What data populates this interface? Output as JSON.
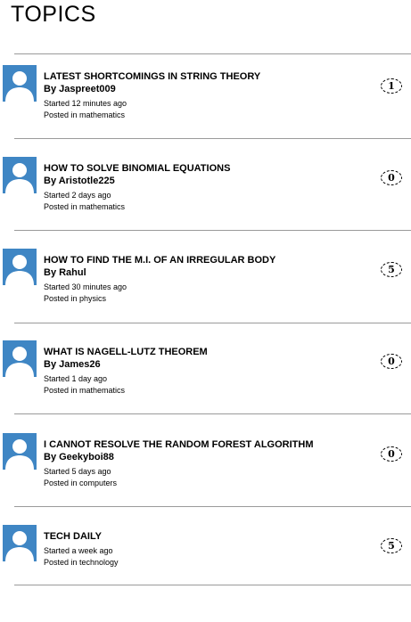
{
  "page": {
    "title": "TOPICS"
  },
  "topics": [
    {
      "title": "LATEST SHORTCOMINGS IN STRING THEORY",
      "author": "By Jaspreet009",
      "started": "Started 12 minutes ago",
      "posted": "Posted in mathematics",
      "count": "1"
    },
    {
      "title": "HOW TO SOLVE BINOMIAL EQUATIONS",
      "author": "By Aristotle225",
      "started": "Started 2 days ago",
      "posted": "Posted in mathematics",
      "count": "0"
    },
    {
      "title": "HOW TO FIND THE M.I. OF AN IRREGULAR BODY",
      "author": "By Rahul",
      "started": "Started 30 minutes ago",
      "posted": "Posted in physics",
      "count": "5"
    },
    {
      "title": "WHAT IS NAGELL-LUTZ THEOREM",
      "author": "By James26",
      "started": "Started 1 day ago",
      "posted": "Posted in mathematics",
      "count": "0"
    },
    {
      "title": "I CANNOT RESOLVE THE RANDOM FOREST ALGORITHM",
      "author": "By Geekyboi88",
      "started": "Started 5 days ago",
      "posted": "Posted in computers",
      "count": "0"
    },
    {
      "title": "TECH DAILY",
      "author": "",
      "started": "Started a week ago",
      "posted": "Posted in technology",
      "count": "5"
    }
  ],
  "colors": {
    "avatar_bg": "#3f86c4",
    "avatar_fg": "#ffffff",
    "divider": "#9a9a9a"
  },
  "icons": {
    "avatar": "user-avatar-icon"
  }
}
